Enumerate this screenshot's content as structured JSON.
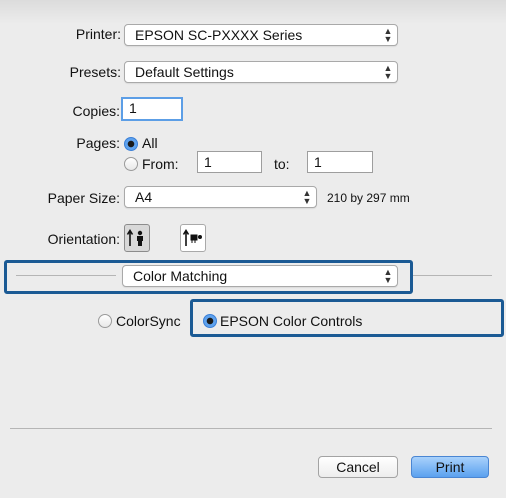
{
  "printer": {
    "label": "Printer:",
    "value": "EPSON SC-PXXXX Series"
  },
  "presets": {
    "label": "Presets:",
    "value": "Default Settings"
  },
  "copies": {
    "label": "Copies:",
    "value": "1"
  },
  "pages": {
    "label": "Pages:",
    "all_label": "All",
    "from_label": "From:",
    "from_value": "1",
    "to_label": "to:",
    "to_value": "1"
  },
  "paper_size": {
    "label": "Paper Size:",
    "value": "A4",
    "dimensions": "210 by 297 mm"
  },
  "orientation": {
    "label": "Orientation:"
  },
  "panel": {
    "value": "Color Matching"
  },
  "color_options": {
    "colorsync_label": "ColorSync",
    "epson_label": "EPSON Color Controls",
    "selected": "EPSON Color Controls"
  },
  "buttons": {
    "cancel_label": "Cancel",
    "print_label": "Print"
  },
  "colors": {
    "highlight": "#1b5a94",
    "accent": "#5ea2ee"
  }
}
